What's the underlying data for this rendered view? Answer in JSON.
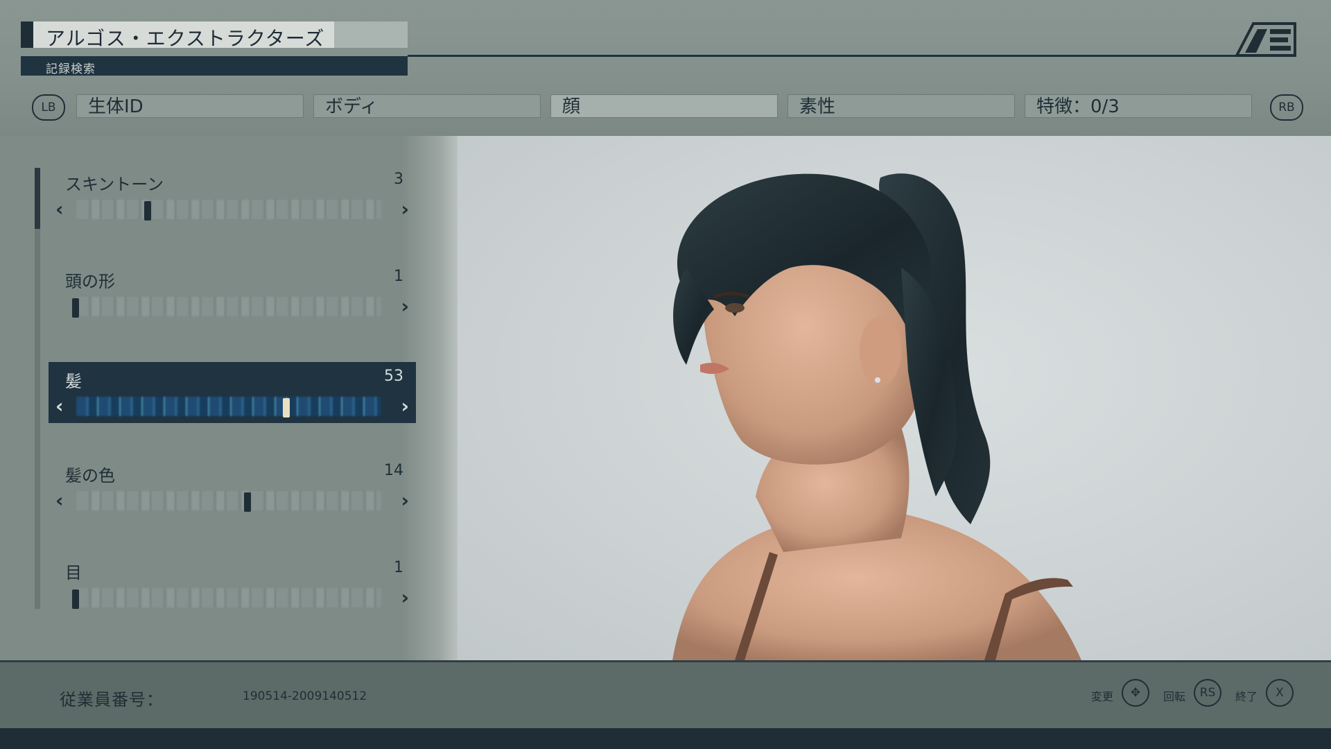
{
  "header": {
    "title": "アルゴス・エクストラクターズ",
    "subtitle": "記録検索",
    "logo": "AE-logo",
    "left_bumper": "LB",
    "right_bumper": "RB",
    "tabs": [
      {
        "label": "生体ID",
        "active": false
      },
      {
        "label": "ボディ",
        "active": false
      },
      {
        "label": "顔",
        "active": true
      },
      {
        "label": "素性",
        "active": false
      },
      {
        "label": "特徴：0/3",
        "active": false
      }
    ]
  },
  "sliders": [
    {
      "label": "スキントーン",
      "value": "3",
      "selected": false,
      "has_left_arrow": true
    },
    {
      "label": "頭の形",
      "value": "1",
      "selected": false,
      "has_left_arrow": false
    },
    {
      "label": "髪",
      "value": "53",
      "selected": true,
      "has_left_arrow": true
    },
    {
      "label": "髪の色",
      "value": "14",
      "selected": false,
      "has_left_arrow": true
    },
    {
      "label": "目",
      "value": "1",
      "selected": false,
      "has_left_arrow": false
    }
  ],
  "arrows": {
    "left": "‹",
    "right": "›"
  },
  "footer": {
    "employee_label": "従業員番号：",
    "employee_id": "190514-2009140512",
    "hints": [
      {
        "label": "変更",
        "button": "✥"
      },
      {
        "label": "回転",
        "button": "RS"
      },
      {
        "label": "終了",
        "button": "X"
      }
    ]
  },
  "colors": {
    "accent_dark": "#1f3340",
    "background": "#7e8a86",
    "viewport": "#cdd3d4"
  }
}
